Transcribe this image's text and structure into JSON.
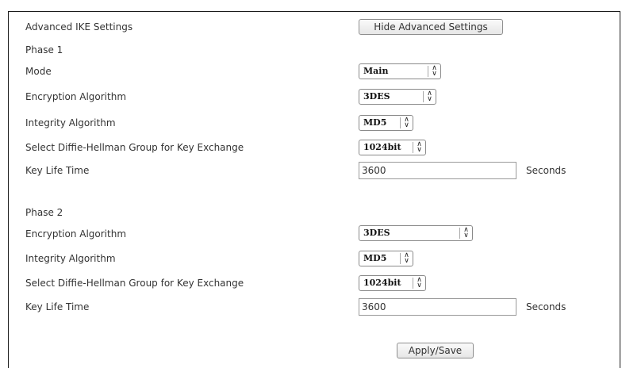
{
  "advanced": {
    "label": "Advanced IKE Settings",
    "button": "Hide Advanced Settings"
  },
  "phase1": {
    "title": "Phase 1",
    "mode_label": "Mode",
    "mode_value": "Main",
    "enc_label": "Encryption Algorithm",
    "enc_value": "3DES",
    "int_label": "Integrity Algorithm",
    "int_value": "MD5",
    "dh_label": "Select Diffie-Hellman Group for Key Exchange",
    "dh_value": "1024bit",
    "life_label": "Key Life Time",
    "life_value": "3600",
    "life_unit": "Seconds"
  },
  "phase2": {
    "title": "Phase 2",
    "enc_label": "Encryption Algorithm",
    "enc_value": "3DES",
    "int_label": "Integrity Algorithm",
    "int_value": "MD5",
    "dh_label": "Select Diffie-Hellman Group for Key Exchange",
    "dh_value": "1024bit",
    "life_label": "Key Life Time",
    "life_value": "3600",
    "life_unit": "Seconds"
  },
  "apply_label": "Apply/Save",
  "icons": {
    "select_arrow": "up-down-chevron-icon"
  }
}
